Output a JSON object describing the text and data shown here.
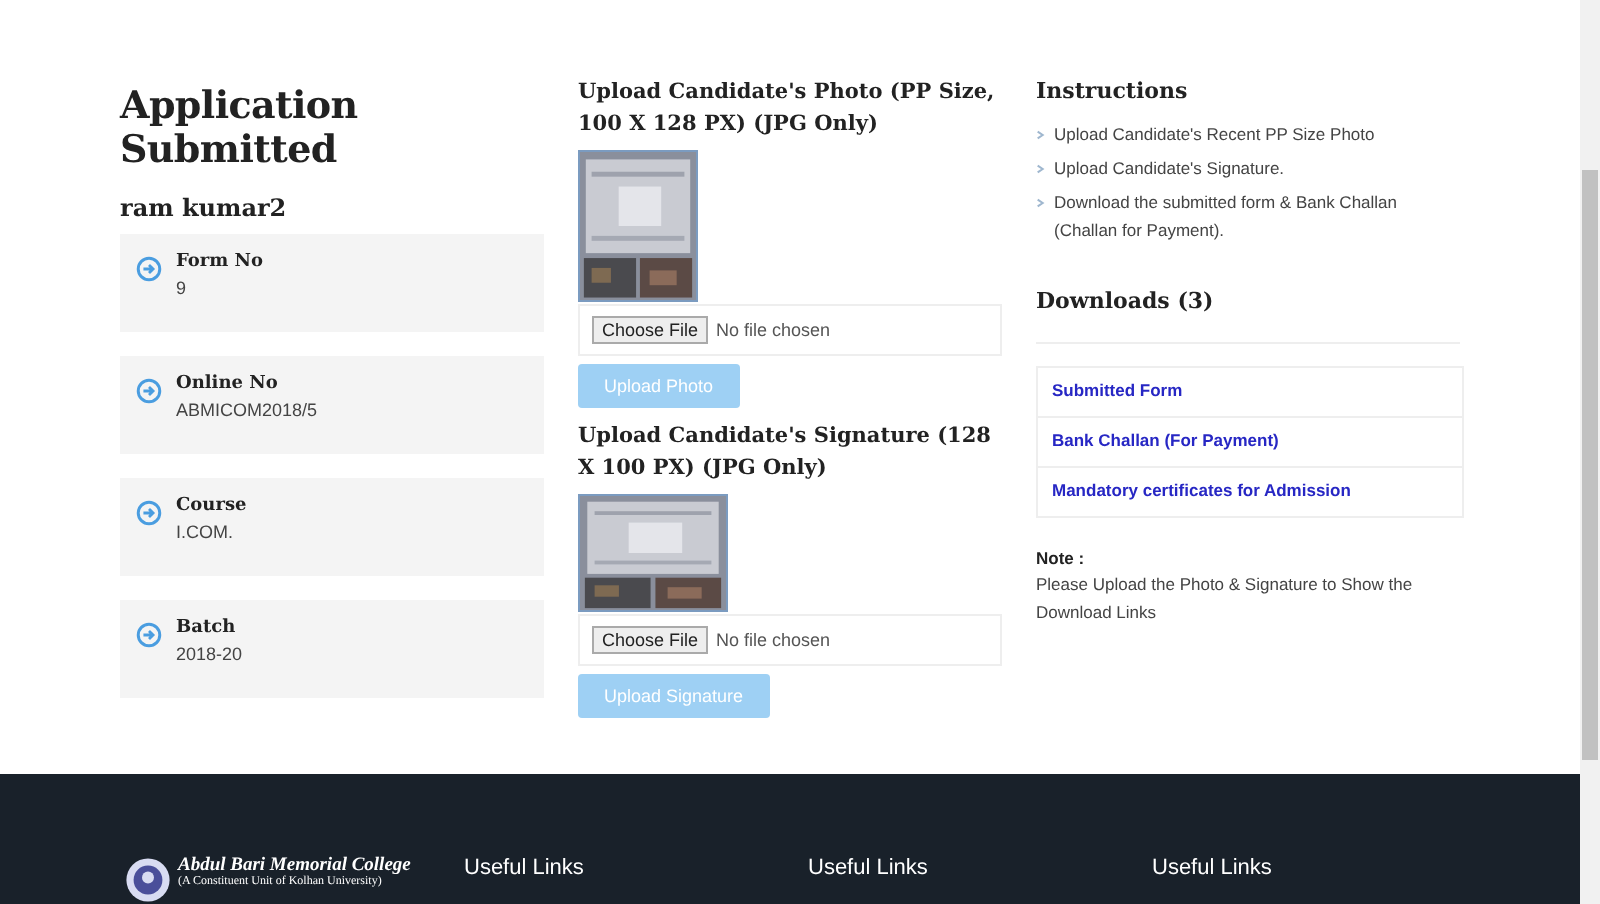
{
  "title": "Application Submitted",
  "candidate_name": "ram kumar2",
  "info_cards": [
    {
      "label": "Form No",
      "value": "9"
    },
    {
      "label": "Online No",
      "value": "ABMICOM2018/5"
    },
    {
      "label": "Course",
      "value": "I.COM."
    },
    {
      "label": "Batch",
      "value": "2018-20"
    }
  ],
  "uploads": [
    {
      "heading": "Upload Candidate's Photo (PP Size, 100 X 128 PX) (JPG Only)",
      "file_button": "Choose File",
      "file_status": "No file chosen",
      "submit": {
        "label": "Upload Photo",
        "disabled": true
      }
    },
    {
      "heading": "Upload Candidate's Signature (128 X 100 PX) (JPG Only)",
      "file_button": "Choose File",
      "file_status": "No file chosen",
      "submit": {
        "label": "Upload Signature",
        "disabled": true
      }
    }
  ],
  "instructions": {
    "heading": "Instructions",
    "items": [
      "Upload Candidate's Recent PP Size Photo",
      "Upload Candidate's Signature.",
      "Download the submitted form & Bank Challan (Challan for Payment)."
    ]
  },
  "downloads": {
    "heading": "Downloads (3)",
    "links": [
      "Submitted Form",
      "Bank Challan (For Payment)",
      "Mandatory certificates for Admission"
    ]
  },
  "note": {
    "label": "Note :",
    "text": "Please Upload the Photo & Signature to Show the Download Links"
  },
  "footer": {
    "college_name": "Abdul Bari Memorial College",
    "college_subtitle": "(A Constituent Unit of Kolhan University)",
    "columns": [
      "Useful Links",
      "Useful Links",
      "Useful Links"
    ]
  }
}
